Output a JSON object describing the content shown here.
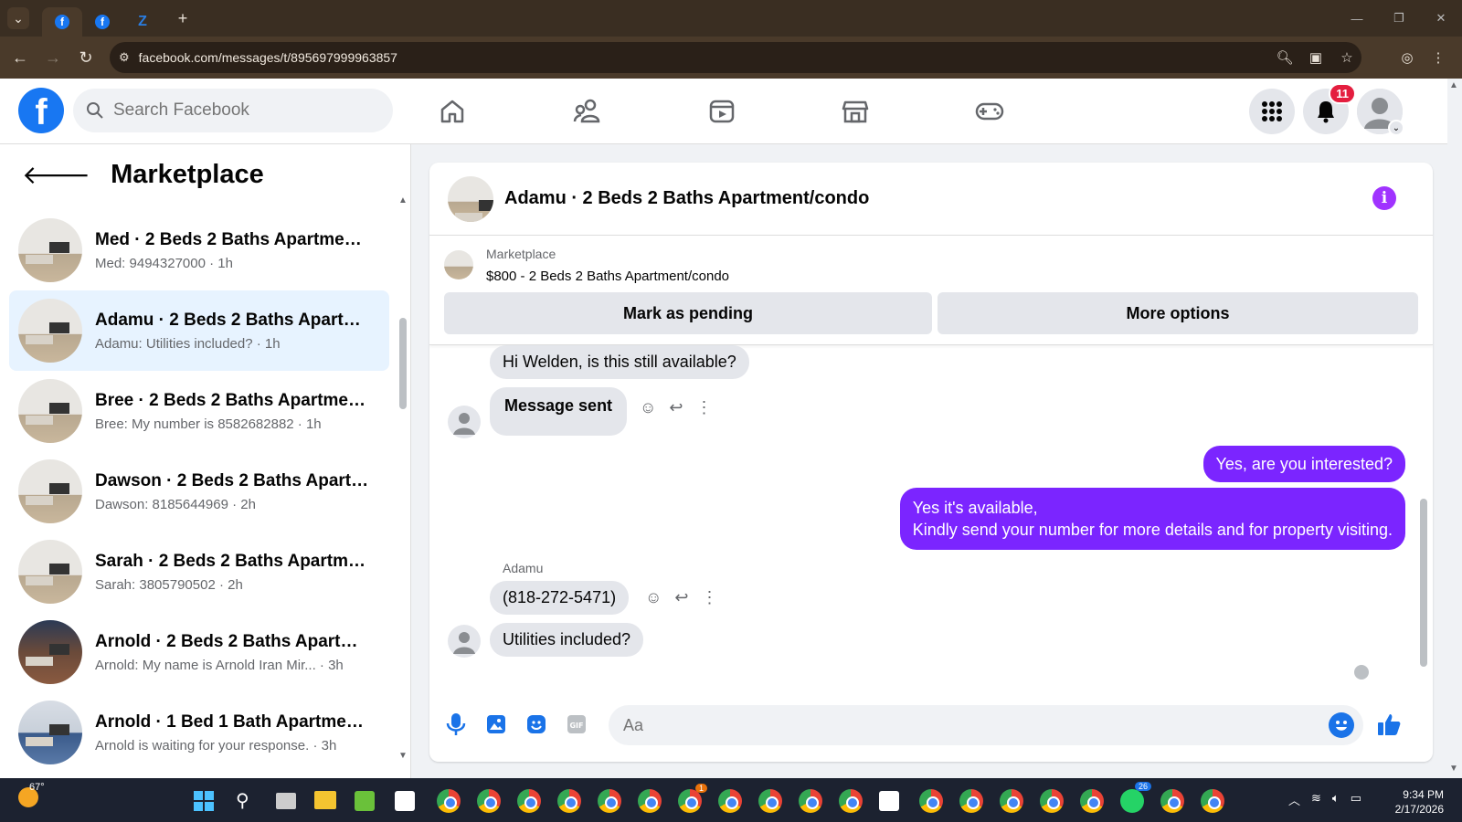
{
  "browser": {
    "url": "facebook.com/messages/t/895697999963857",
    "new_tab": "+"
  },
  "fb": {
    "search_placeholder": "Search Facebook",
    "notification_count": "11"
  },
  "sidebar": {
    "title": "Marketplace",
    "conversations": [
      {
        "title": "Med · 2 Beds 2 Baths Apartment...",
        "preview": "Med: 9494327000 · 1h",
        "thumb": "room"
      },
      {
        "title": "Adamu · 2 Beds 2 Baths Apartme...",
        "preview": "Adamu: Utilities included? · 1h",
        "thumb": "room"
      },
      {
        "title": "Bree · 2 Beds 2 Baths Apartment...",
        "preview": "Bree: My number is 8582682882 · 1h",
        "thumb": "room"
      },
      {
        "title": "Dawson · 2 Beds 2 Baths Apartm...",
        "preview": "Dawson: 8185644969 · 2h",
        "thumb": "room"
      },
      {
        "title": "Sarah · 2 Beds 2 Baths Apartmen...",
        "preview": "Sarah: 3805790502 · 2h",
        "thumb": "room"
      },
      {
        "title": "Arnold · 2 Beds 2 Baths Apartme...",
        "preview": "Arnold: My name is Arnold Iran Mir... · 3h",
        "thumb": "dark"
      },
      {
        "title": "Arnold · 1 Bed 1 Bath Apartment/...",
        "preview": "Arnold is waiting for your response. · 3h",
        "thumb": "blue"
      }
    ]
  },
  "chat": {
    "header_title": "Adamu · 2 Beds 2 Baths Apartment/condo",
    "listing_label": "Marketplace",
    "listing_title": "$800 - 2 Beds 2 Baths Apartment/condo",
    "mark_pending": "Mark as pending",
    "more_options": "More options",
    "messages": {
      "m1": "Hi Welden, is this still available?",
      "m2": "Message sent",
      "m3": "Yes, are you interested?",
      "m4_line1": "Yes it's available,",
      "m4_line2": "Kindly send your number for more details and for property visiting.",
      "sender_name": "Adamu",
      "m5": "(818-272-5471)",
      "m6": "Utilities included?"
    },
    "composer_placeholder": "Aa",
    "accent_color": "#7b25ff"
  },
  "taskbar": {
    "temperature": "67°",
    "time": "9:34 PM",
    "date": "2/17/2026",
    "whatsapp_badge": "26",
    "chrome_badge": "1"
  }
}
